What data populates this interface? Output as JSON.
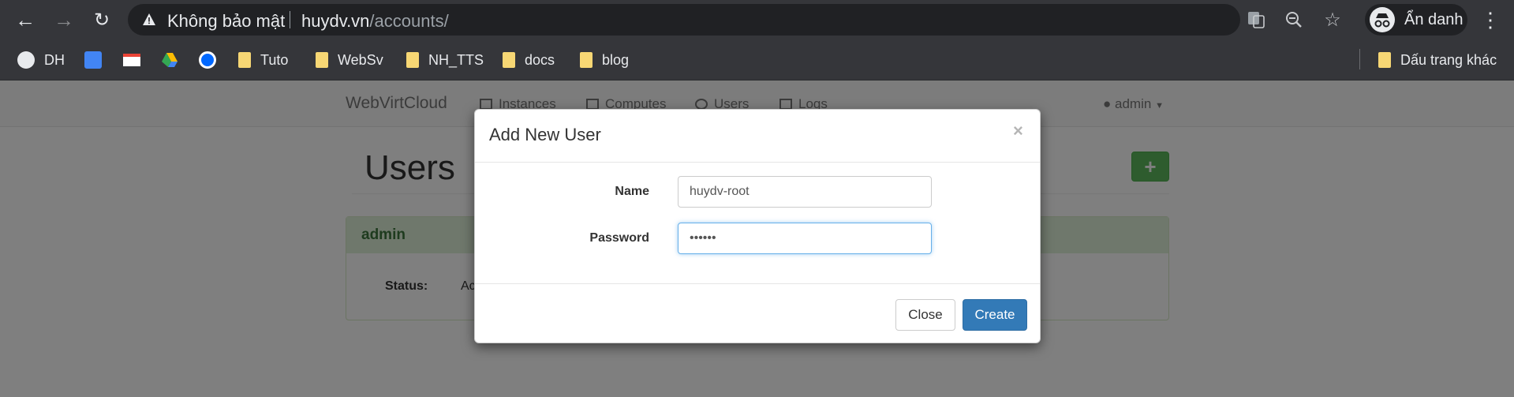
{
  "browser": {
    "omnibox": {
      "security_label": "Không bảo mật",
      "url_host": "huydv.vn",
      "url_path": "/accounts/"
    },
    "profile_label": "Ẩn danh",
    "bookmarks": [
      {
        "label": "DH",
        "icon": "github-icon"
      },
      {
        "label": "",
        "icon": "google-translate-icon"
      },
      {
        "label": "",
        "icon": "gmail-icon"
      },
      {
        "label": "",
        "icon": "google-drive-icon"
      },
      {
        "label": "",
        "icon": "zalo-icon"
      },
      {
        "label": "Tuto",
        "icon": "folder-icon"
      },
      {
        "label": "WebSv",
        "icon": "folder-icon"
      },
      {
        "label": "NH_TTS",
        "icon": "folder-icon"
      },
      {
        "label": "docs",
        "icon": "folder-icon"
      },
      {
        "label": "blog",
        "icon": "folder-icon"
      }
    ],
    "other_bookmarks": "Dấu trang khác"
  },
  "navbar": {
    "brand": "WebVirtCloud",
    "links": [
      "Instances",
      "Computes",
      "Users",
      "Logs"
    ],
    "user": "admin"
  },
  "page": {
    "title": "Users",
    "panel": {
      "heading": "admin",
      "status_label": "Status:",
      "status_value": "Ac"
    }
  },
  "modal": {
    "title": "Add New User",
    "close_symbol": "×",
    "name_label": "Name",
    "name_value": "huydv-root",
    "password_label": "Password",
    "password_value": "••••••",
    "close_button": "Close",
    "create_button": "Create"
  },
  "colors": {
    "chrome_bg": "#35363a",
    "omnibox_bg": "#202124",
    "success": "#5cb85c",
    "primary": "#337ab7"
  }
}
